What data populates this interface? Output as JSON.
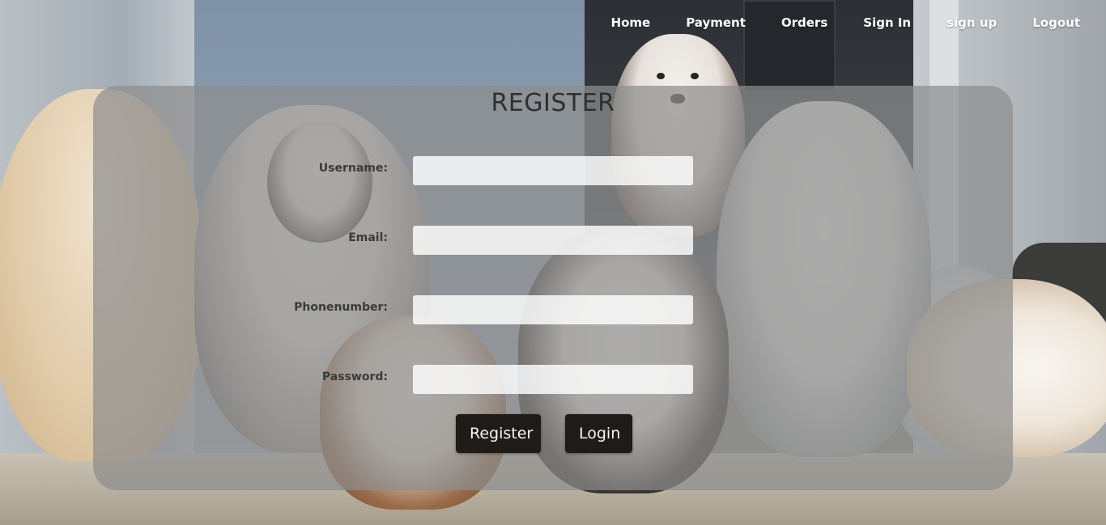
{
  "nav": {
    "items": [
      {
        "label": "Home"
      },
      {
        "label": "Payment"
      },
      {
        "label": "Orders"
      },
      {
        "label": "Sign In"
      },
      {
        "label": "sign up"
      },
      {
        "label": "Logout"
      }
    ]
  },
  "form": {
    "title": "REGISTER",
    "fields": [
      {
        "label": "Username:",
        "value": "",
        "placeholder": ""
      },
      {
        "label": "Email:",
        "value": "",
        "placeholder": ""
      },
      {
        "label": "Phonenumber:",
        "value": "",
        "placeholder": ""
      },
      {
        "label": "Password:",
        "value": "",
        "placeholder": ""
      }
    ],
    "register_label": "Register",
    "login_label": "Login"
  },
  "colors": {
    "button_bg": "#1f1b19",
    "panel_bg": "rgba(142,142,142,0.72)",
    "nav_text": "#ffffff"
  }
}
